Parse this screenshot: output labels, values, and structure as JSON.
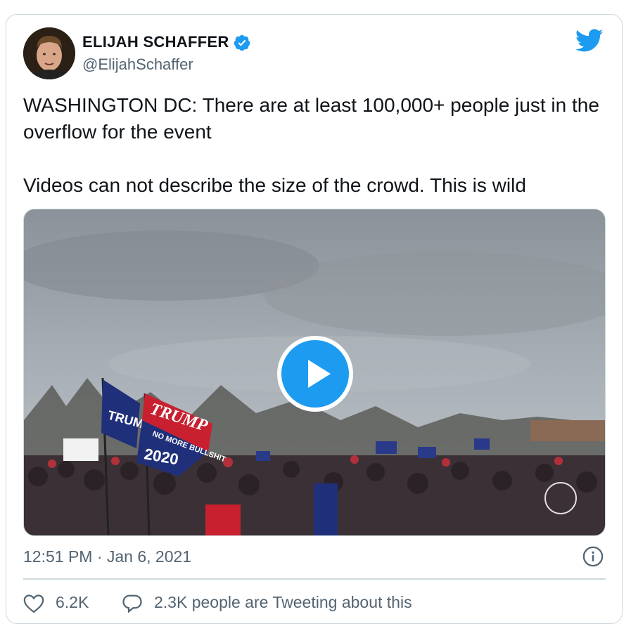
{
  "author": {
    "name": "ELIJAH SCHAFFER",
    "handle": "@ElijahSchaffer",
    "verified": true
  },
  "tweet": {
    "line1": "WASHINGTON DC: There are at least 100,000+ people just in the overflow for the event",
    "line2": "Videos can not describe the size of the crowd. This is wild"
  },
  "media": {
    "type": "video",
    "play_icon": "play-icon",
    "flags": {
      "trump_left": "TRUMP",
      "trump_red": "TRUMP",
      "no_more": "NO MORE BULLSHIT",
      "year": "2020"
    }
  },
  "meta": {
    "timestamp": "12:51 PM · Jan 6, 2021"
  },
  "actions": {
    "likes": "6.2K",
    "replies_text": "2.3K people are Tweeting about this"
  },
  "colors": {
    "accent": "#1d9bf0",
    "text": "#0f1419",
    "muted": "#536471",
    "border": "#cfd9de"
  }
}
